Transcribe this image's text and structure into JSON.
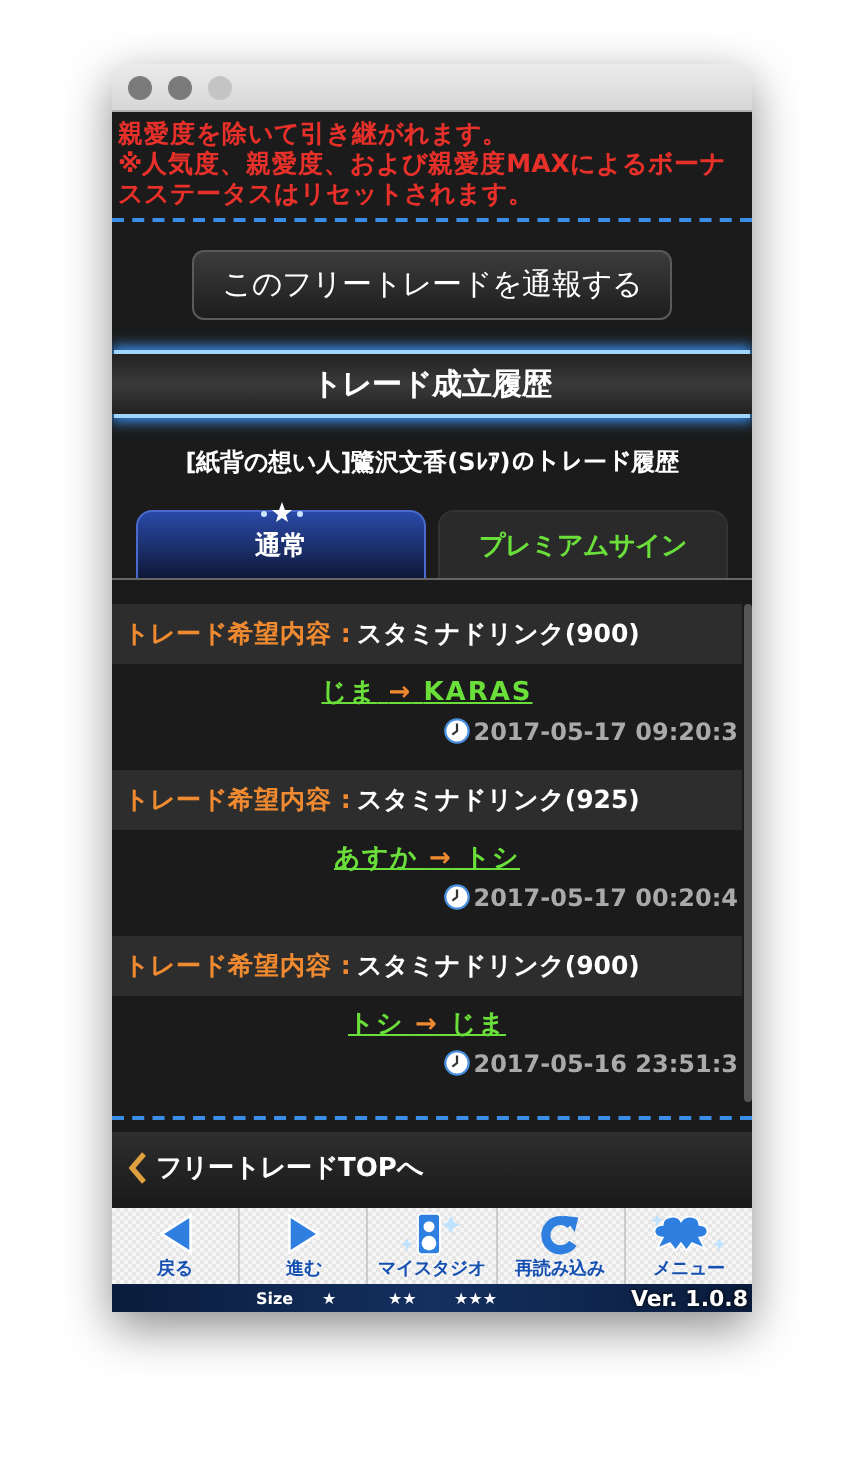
{
  "notice": {
    "lines": [
      "親愛度を除いて引き継がれます。",
      "※人気度、親愛度、および親愛度MAXによるボーナスステータスはリセットされます。"
    ]
  },
  "report_button": {
    "label": "このフリートレードを通報する"
  },
  "section": {
    "title": "トレード成立履歴",
    "subtitle": "[紙背の想い人]鷺沢文香(Sﾚｱ)のトレード履歴"
  },
  "tabs": [
    {
      "label": "通常",
      "selected": true
    },
    {
      "label": "プレミアムサイン",
      "selected": false
    }
  ],
  "trades": [
    {
      "label": "トレード希望内容 :",
      "item": "スタミナドリンク(900)",
      "from": "じま",
      "arrow": "→",
      "to": "KARAS",
      "time": "2017-05-17 09:20:3"
    },
    {
      "label": "トレード希望内容 :",
      "item": "スタミナドリンク(925)",
      "from": "あすか",
      "arrow": "→",
      "to": "トシ",
      "time": "2017-05-17 00:20:4"
    },
    {
      "label": "トレード希望内容 :",
      "item": "スタミナドリンク(900)",
      "from": "トシ",
      "arrow": "→",
      "to": "じま",
      "time": "2017-05-16 23:51:3"
    }
  ],
  "back_link": {
    "label": "フリートレードTOPへ"
  },
  "toolbar": [
    {
      "kind": "back",
      "label": "戻る"
    },
    {
      "kind": "forward",
      "label": "進む"
    },
    {
      "kind": "studio",
      "label": "マイスタジオ"
    },
    {
      "kind": "reload",
      "label": "再読み込み"
    },
    {
      "kind": "menu",
      "label": "メニュー"
    }
  ],
  "footer": {
    "size_label": "Size",
    "sizes": [
      "★",
      "★★",
      "★★★"
    ],
    "version": "Ver. 1.0.8"
  }
}
